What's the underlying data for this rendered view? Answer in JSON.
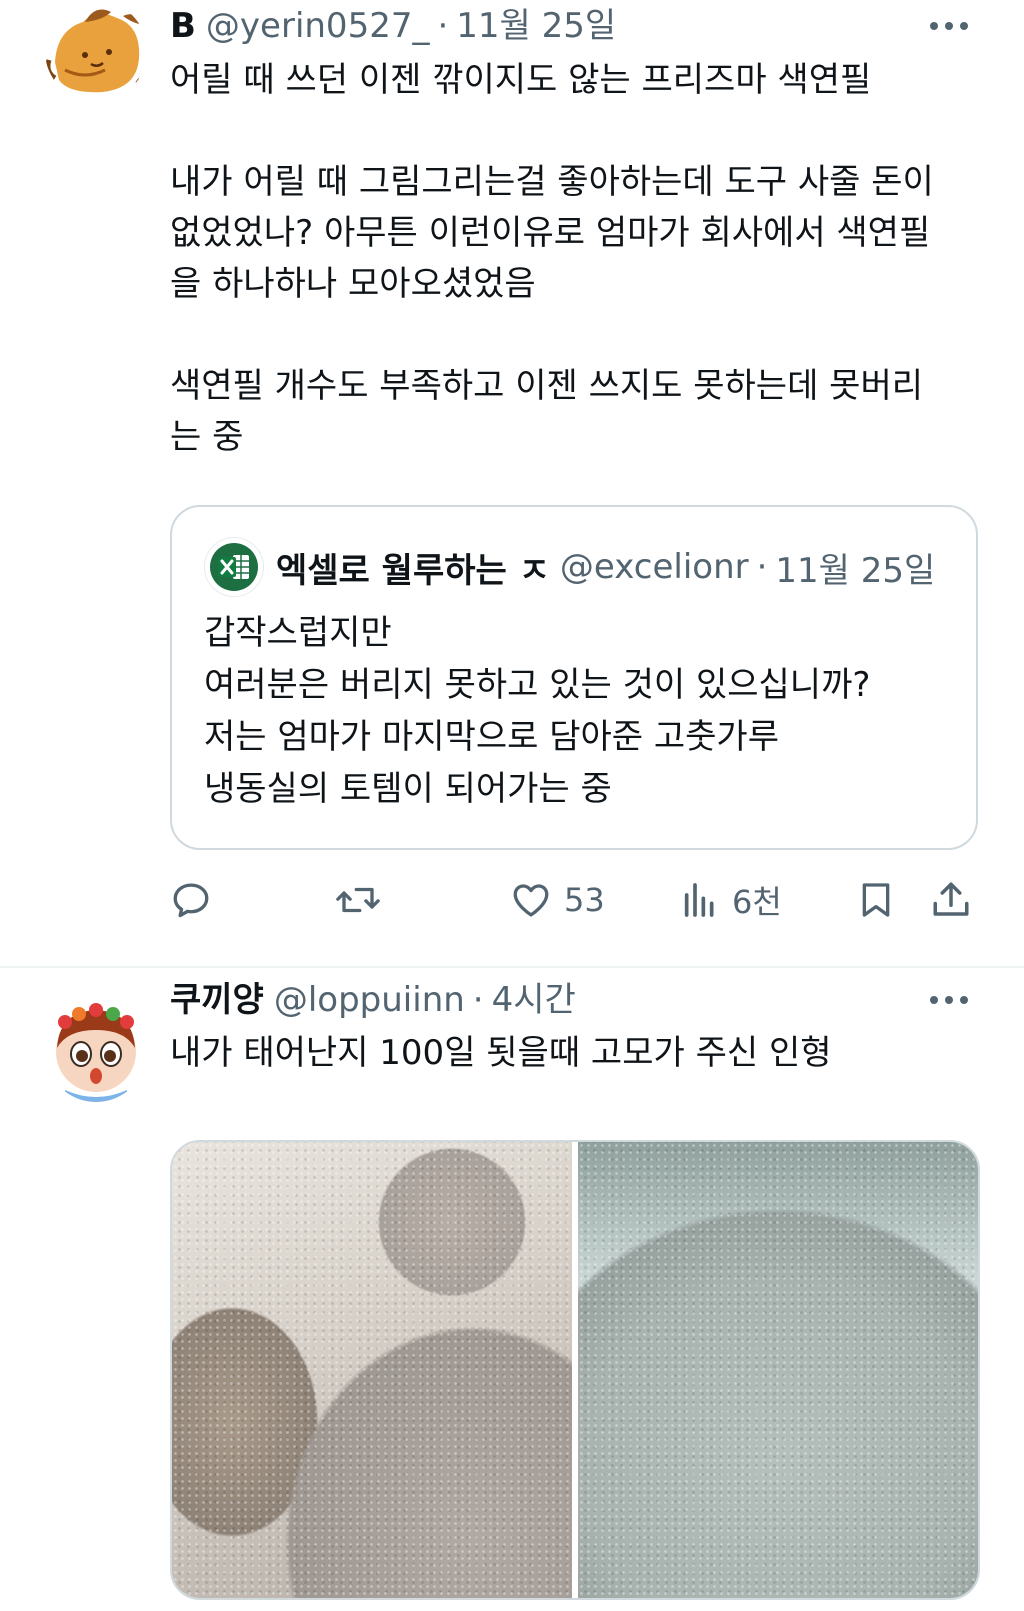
{
  "posts": [
    {
      "display_name": "B",
      "handle": "@yerin0527_",
      "separator": "·",
      "time": "11월 25일",
      "more_icon": "more-horizontal-icon",
      "text": "어릴 때 쓰던 이젠 깎이지도 않는 프리즈마 색연필\n\n내가 어릴 때 그림그리는걸 좋아하는데 도구 사줄 돈이\n없었었나? 아무튼 이런이유로 엄마가 회사에서 색연필\n을 하나하나 모아오셨었음\n\n색연필 개수도 부족하고 이젠 쓰지도 못하는데 못버리\n는 중",
      "quote": {
        "display_name": "엑셀로 월루하는 ㅈ",
        "handle": "@excelionr",
        "separator": "·",
        "time": "11월 25일",
        "avatar_icon": "excel-icon",
        "text": "갑작스럽지만\n여러분은 버리지 못하고 있는 것이 있으십니까?\n저는 엄마가 마지막으로 담아준 고춧가루\n냉동실의 토템이 되어가는 중"
      },
      "actions": {
        "reply_count": "",
        "repost_count": "",
        "like_count": "53",
        "view_count": "6천"
      }
    },
    {
      "display_name": "쿠끼양",
      "handle": "@loppuiinn",
      "separator": "·",
      "time": "4시간",
      "more_icon": "more-horizontal-icon",
      "text": "내가 태어난지 100일 됫을때 고모가 주신 인형"
    }
  ],
  "colors": {
    "text_primary": "#0f1419",
    "text_secondary": "#536471",
    "border": "#cfd9de",
    "excel_green": "#107c41"
  }
}
